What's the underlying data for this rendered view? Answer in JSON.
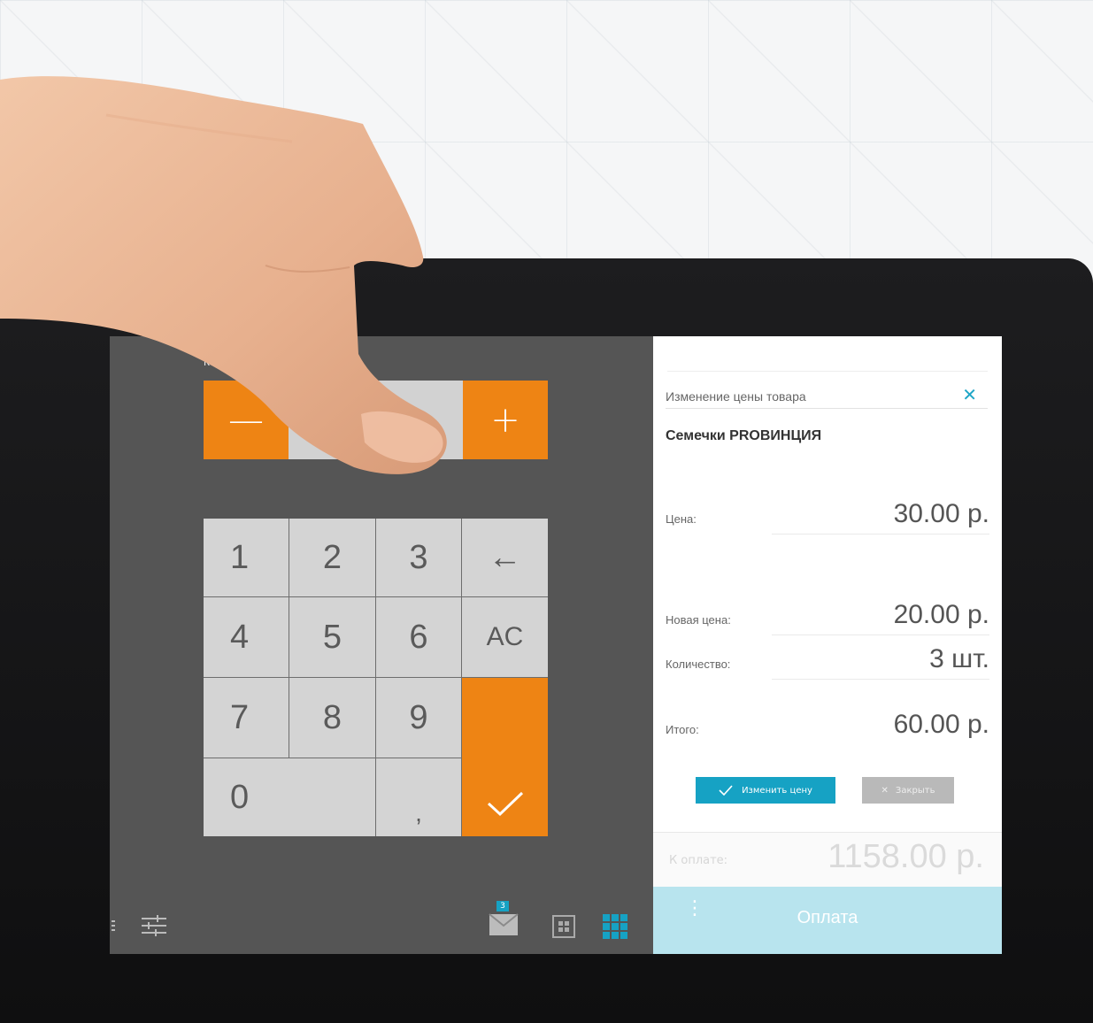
{
  "colors": {
    "accent": "#ee8414",
    "primary": "#16a2c4",
    "key_bg": "#d4d4d4",
    "panel_bg": "#555555"
  },
  "left": {
    "quantity_label": "Ко",
    "qty_minus": "—",
    "qty_plus": "+",
    "qty_value": "",
    "keys": {
      "k1": "1",
      "k2": "2",
      "k3": "3",
      "backspace": "←",
      "k4": "4",
      "k5": "5",
      "k6": "6",
      "ac": "AC",
      "k7": "7",
      "k8": "8",
      "k9": "9",
      "k0": "0",
      "comma": ",",
      "ok": "✓"
    },
    "toolbar": {
      "menu_icon": "menu-icon",
      "settings_icon": "sliders-icon",
      "mail_badge": "3",
      "mail_icon": "mail-icon",
      "grid_small_icon": "grid-4-icon",
      "grid_large_icon": "grid-9-icon"
    }
  },
  "dialog": {
    "title": "Изменение цены товара",
    "close": "✕",
    "product_name": "Семечки PROВИНЦИЯ",
    "price_label": "Цена:",
    "price_value": "30.00 р.",
    "new_price_label": "Новая цена:",
    "new_price_value": "20.00 р.",
    "quantity_label": "Количество:",
    "quantity_value": "3 шт.",
    "total_label": "Итого:",
    "total_value": "60.00 р.",
    "change_button": "Изменить цену",
    "close_button": "Закрыть"
  },
  "footer": {
    "to_pay_label": "К оплате:",
    "to_pay_value": "1158.00 р.",
    "pay_button": "Оплата"
  }
}
